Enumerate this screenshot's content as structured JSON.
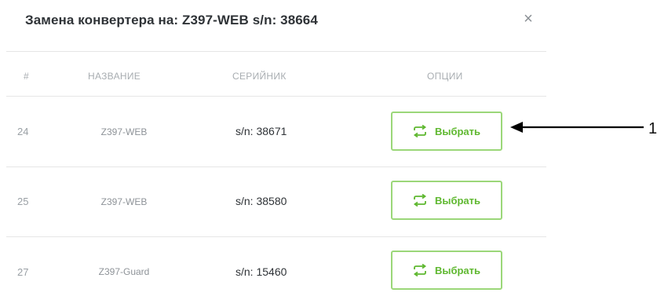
{
  "modal": {
    "title": "Замена конвертера на: Z397-WEB s/n: 38664",
    "close_icon": "close-icon"
  },
  "table": {
    "headers": {
      "num": "#",
      "name": "НАЗВАНИЕ",
      "serial": "СЕРИЙНИК",
      "options": "ОПЦИИ"
    },
    "rows": [
      {
        "num": "24",
        "name": "Z397-WEB",
        "serial": "s/n: 38671",
        "action": "Выбрать"
      },
      {
        "num": "25",
        "name": "Z397-WEB",
        "serial": "s/n: 38580",
        "action": "Выбрать"
      },
      {
        "num": "27",
        "name": "Z397-Guard",
        "serial": "s/n: 15460",
        "action": "Выбрать"
      }
    ],
    "action_icon": "swap-arrows-icon",
    "accent_color": "#5fb830"
  },
  "annotation": {
    "label": "1"
  }
}
